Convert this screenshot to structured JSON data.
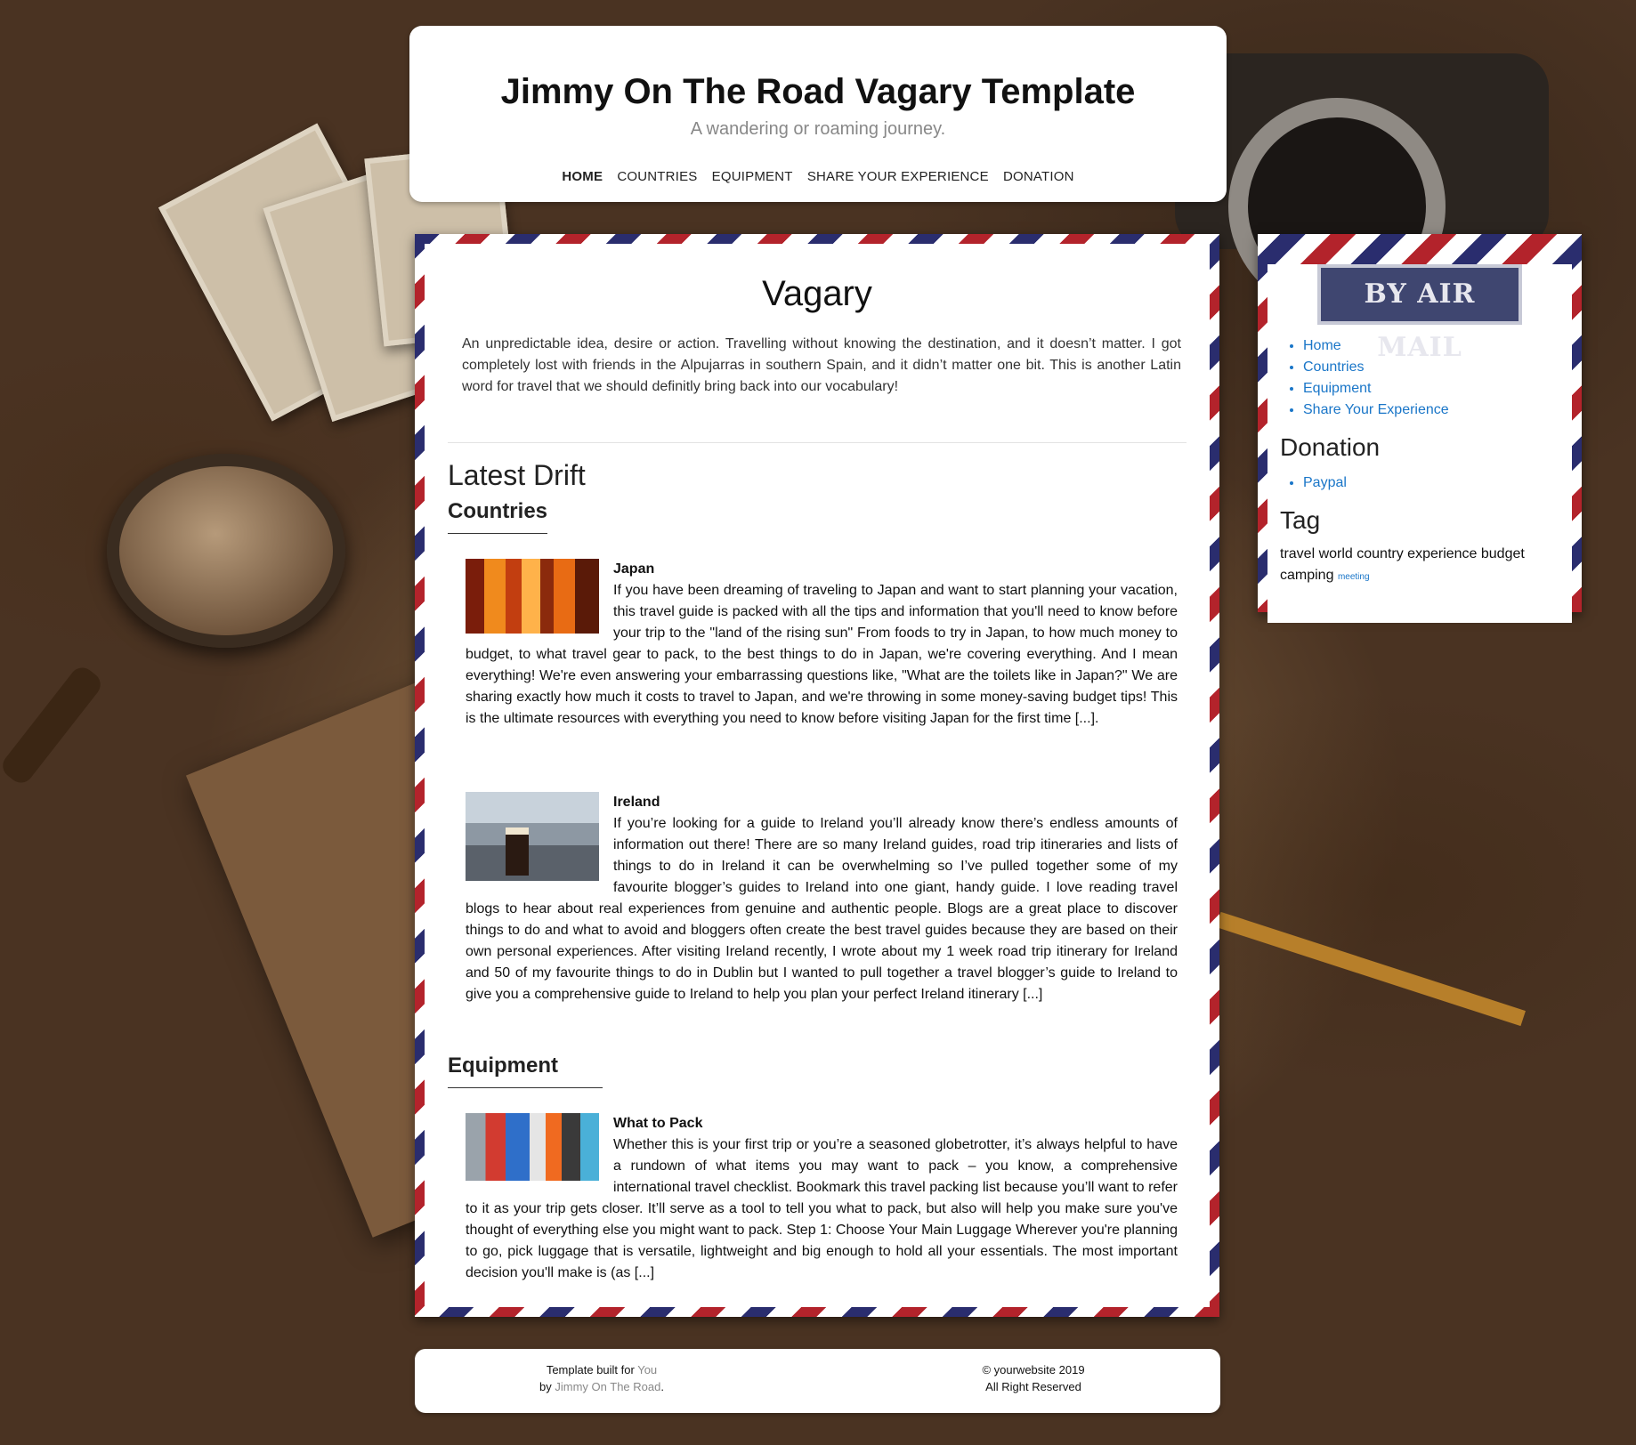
{
  "header": {
    "title": "Jimmy On The Road Vagary Template",
    "tagline": "A wandering or roaming journey.",
    "nav": [
      "HOME",
      "COUNTRIES",
      "EQUIPMENT",
      "SHARE YOUR EXPERIENCE",
      "DONATION"
    ]
  },
  "main": {
    "title": "Vagary",
    "intro": "An unpredictable idea, desire or action. Travelling without knowing the destination, and it doesn’t matter. I got completely lost with friends in the Alpujarras in southern Spain, and it didn’t matter one bit. This is another Latin word for travel that we should definitly bring back into our vocabulary!",
    "latest_heading": "Latest Drift",
    "categories": [
      {
        "title": "Countries",
        "posts": [
          {
            "title": "Japan",
            "excerpt": "If you have been dreaming of traveling to Japan and want to start planning your vacation, this travel guide is packed with all the tips and information that you'll need to know before your trip to the \"land of the rising sun\" From foods to try in Japan, to how much money to budget, to what travel gear to pack, to the best things to do in Japan, we're covering everything. And I mean everything! We're even answering your embarrassing questions like, \"What are the toilets like in Japan?\" We are sharing exactly how much it costs to travel to Japan, and we're throwing in some money-saving budget tips! This is the ultimate resources with everything you need to know before visiting Japan for the first time [...]."
          },
          {
            "title": "Ireland",
            "excerpt": "If you’re looking for a guide to Ireland you’ll already know there’s endless amounts of information out there! There are so many Ireland guides, road trip itineraries and lists of things to do in Ireland it can be overwhelming so I’ve pulled together some of my favourite blogger’s guides to Ireland into one giant, handy guide. I love reading travel blogs to hear about real experiences from genuine and authentic people. Blogs are a great place to discover things to do and what to avoid and bloggers often create the best travel guides because they are based on their own personal experiences. After visiting Ireland recently, I wrote about my 1 week road trip itinerary for Ireland and 50 of my favourite things to do in Dublin but I wanted to pull together a travel blogger’s guide to Ireland to give you a comprehensive guide to Ireland to help you plan your perfect Ireland itinerary [...]"
          }
        ]
      },
      {
        "title": "Equipment",
        "posts": [
          {
            "title": "What to Pack",
            "excerpt": "Whether this is your first trip or you’re a seasoned globetrotter, it’s always helpful to have a rundown of what items you may want to pack – you know, a comprehensive international travel checklist. Bookmark this travel packing list because you’ll want to refer to it as your trip gets closer. It’ll serve as a tool to tell you what to pack, but also will help you make sure you've thought of everything else you might want to pack. Step 1: Choose Your Main Luggage Wherever you're planning to go, pick luggage that is versatile, lightweight and big enough to hold all your essentials. The most important decision you'll make is (as [...]"
          }
        ]
      }
    ]
  },
  "sidebar": {
    "stamp": "BY AIR MAIL",
    "links": [
      "Home",
      "Countries",
      "Equipment",
      "Share Your Experience"
    ],
    "donation_heading": "Donation",
    "donation_links": [
      "Paypal"
    ],
    "tag_heading": "Tag",
    "tags": "travel world country experience budget camping",
    "tag_small": "meeting"
  },
  "footer": {
    "left_prefix": "Template built for",
    "left_you": "You",
    "left_by": "by",
    "left_author": "Jimmy On The Road",
    "left_end": ".",
    "right_copy": "© yourwebsite 2019",
    "right_rights": "All Right Reserved"
  },
  "colors": {
    "link": "#1a76c8",
    "airmail_red": "#b3232b",
    "airmail_blue": "#2a2d6e"
  }
}
